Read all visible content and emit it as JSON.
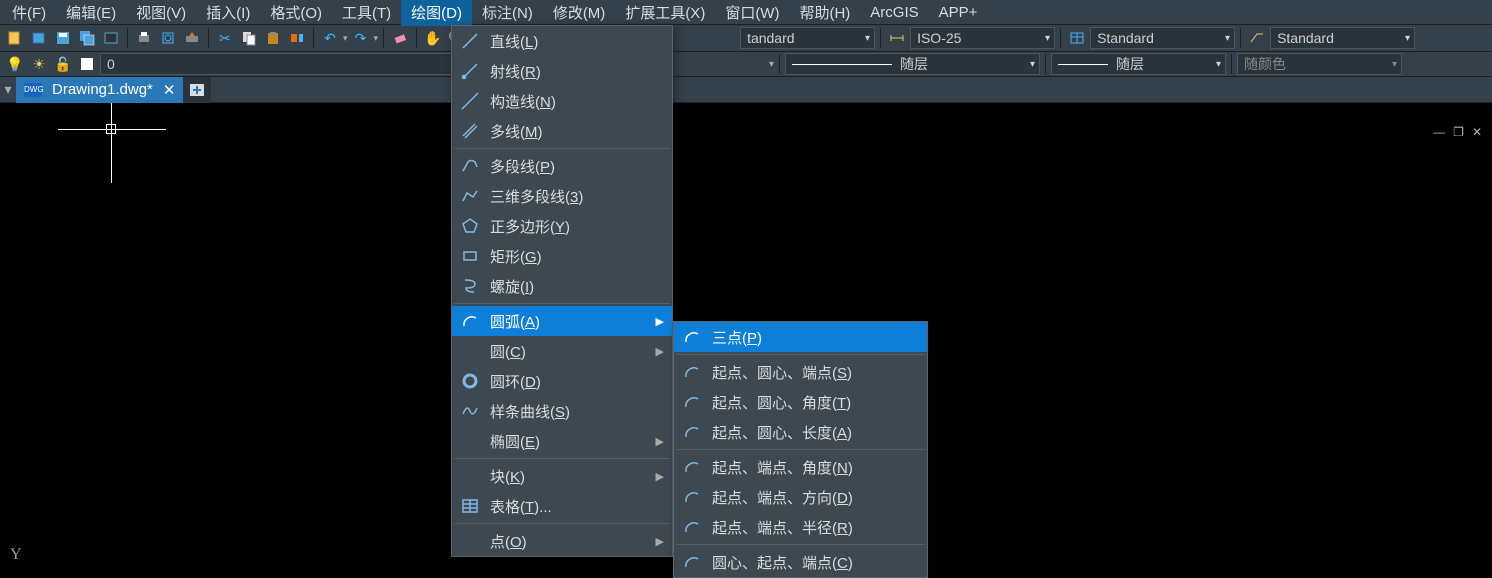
{
  "menubar": {
    "items": [
      {
        "label": "件(F)"
      },
      {
        "label": "编辑(E)"
      },
      {
        "label": "视图(V)"
      },
      {
        "label": "插入(I)"
      },
      {
        "label": "格式(O)"
      },
      {
        "label": "工具(T)"
      },
      {
        "label": "绘图(D)",
        "active": true
      },
      {
        "label": "标注(N)"
      },
      {
        "label": "修改(M)"
      },
      {
        "label": "扩展工具(X)"
      },
      {
        "label": "窗口(W)"
      },
      {
        "label": "帮助(H)"
      },
      {
        "label": "ArcGIS"
      },
      {
        "label": "APP+"
      }
    ]
  },
  "toolbar": {
    "text_style": "tandard",
    "dim_style": "ISO-25",
    "table_style": "Standard",
    "mleader_style": "Standard"
  },
  "layer_row": {
    "layer_name": "0",
    "linetype": "随层",
    "lineweight": "随层",
    "color": "随颜色"
  },
  "tabs": {
    "active": "Drawing1.dwg*"
  },
  "draw_menu": {
    "groups": [
      [
        {
          "label_pre": "直线(",
          "mn": "L",
          "label_post": ")",
          "icon": "line"
        },
        {
          "label_pre": "射线(",
          "mn": "R",
          "label_post": ")",
          "icon": "ray"
        },
        {
          "label_pre": "构造线(",
          "mn": "N",
          "label_post": ")",
          "icon": "xline"
        },
        {
          "label_pre": "多线(",
          "mn": "M",
          "label_post": ")",
          "icon": "mline"
        }
      ],
      [
        {
          "label_pre": "多段线(",
          "mn": "P",
          "label_post": ")",
          "icon": "pline"
        },
        {
          "label_pre": "三维多段线(",
          "mn": "3",
          "label_post": ")",
          "icon": "3dpoly"
        },
        {
          "label_pre": "正多边形(",
          "mn": "Y",
          "label_post": ")",
          "icon": "polygon"
        },
        {
          "label_pre": "矩形(",
          "mn": "G",
          "label_post": ")",
          "icon": "rect"
        },
        {
          "label_pre": "螺旋(",
          "mn": "I",
          "label_post": ")",
          "icon": "helix"
        }
      ],
      [
        {
          "label_pre": "圆弧(",
          "mn": "A",
          "label_post": ")",
          "icon": "arc",
          "submenu": true,
          "hl": true
        },
        {
          "label_pre": "圆(",
          "mn": "C",
          "label_post": ")",
          "icon": "",
          "submenu": true
        },
        {
          "label_pre": "圆环(",
          "mn": "D",
          "label_post": ")",
          "icon": "donut"
        },
        {
          "label_pre": "样条曲线(",
          "mn": "S",
          "label_post": ")",
          "icon": "spline"
        },
        {
          "label_pre": "椭圆(",
          "mn": "E",
          "label_post": ")",
          "icon": "",
          "submenu": true
        }
      ],
      [
        {
          "label_pre": "块(",
          "mn": "K",
          "label_post": ")",
          "icon": "",
          "submenu": true
        },
        {
          "label_pre": "表格(",
          "mn": "T",
          "label_post": ")...",
          "icon": "table"
        }
      ],
      [
        {
          "label_pre": "点(",
          "mn": "O",
          "label_post": ")",
          "icon": "",
          "submenu": true
        }
      ]
    ]
  },
  "arc_submenu": {
    "groups": [
      [
        {
          "label_pre": "三点(",
          "mn": "P",
          "label_post": ")",
          "hl": true
        }
      ],
      [
        {
          "label_pre": "起点、圆心、端点(",
          "mn": "S",
          "label_post": ")"
        },
        {
          "label_pre": "起点、圆心、角度(",
          "mn": "T",
          "label_post": ")"
        },
        {
          "label_pre": "起点、圆心、长度(",
          "mn": "A",
          "label_post": ")"
        }
      ],
      [
        {
          "label_pre": "起点、端点、角度(",
          "mn": "N",
          "label_post": ")"
        },
        {
          "label_pre": "起点、端点、方向(",
          "mn": "D",
          "label_post": ")"
        },
        {
          "label_pre": "起点、端点、半径(",
          "mn": "R",
          "label_post": ")"
        }
      ],
      [
        {
          "label_pre": "圆心、起点、端点(",
          "mn": "C",
          "label_post": ")"
        }
      ]
    ]
  }
}
